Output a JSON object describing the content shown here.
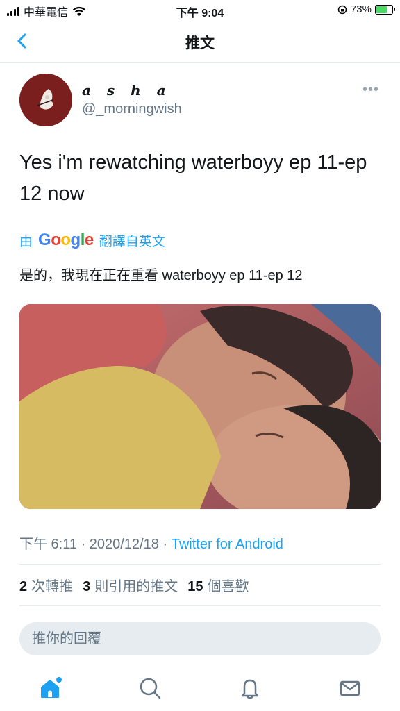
{
  "status_bar": {
    "carrier": "中華電信",
    "time": "下午 9:04",
    "battery": "73%",
    "battery_level": 0.73
  },
  "nav": {
    "title": "推文",
    "back_icon": "chevron-left-icon"
  },
  "tweet": {
    "display_name": "a s h a",
    "handle": "@_morningwish",
    "text": "Yes i'm rewatching waterboyy ep 11-ep 12 now",
    "translate_prefix": "由",
    "translate_brand": "Google",
    "translate_suffix": "翻譯自英文",
    "translation": "是的，我現在正在重看 waterboyy ep 11-ep 12",
    "time": "下午 6:11",
    "date": "2020/12/18",
    "separator": "·",
    "source": "Twitter for Android",
    "stats": {
      "retweets_count": "2",
      "retweets_label": "次轉推",
      "quotes_count": "3",
      "quotes_label": "則引用的推文",
      "likes_count": "15",
      "likes_label": "個喜歡"
    }
  },
  "reply": {
    "placeholder": "推你的回覆"
  },
  "tabs": [
    {
      "name": "home-icon",
      "active": true
    },
    {
      "name": "search-icon",
      "active": false
    },
    {
      "name": "bell-icon",
      "active": false
    },
    {
      "name": "mail-icon",
      "active": false
    }
  ],
  "colors": {
    "accent": "#1da1f2",
    "text": "#14171a",
    "secondary": "#657786"
  }
}
